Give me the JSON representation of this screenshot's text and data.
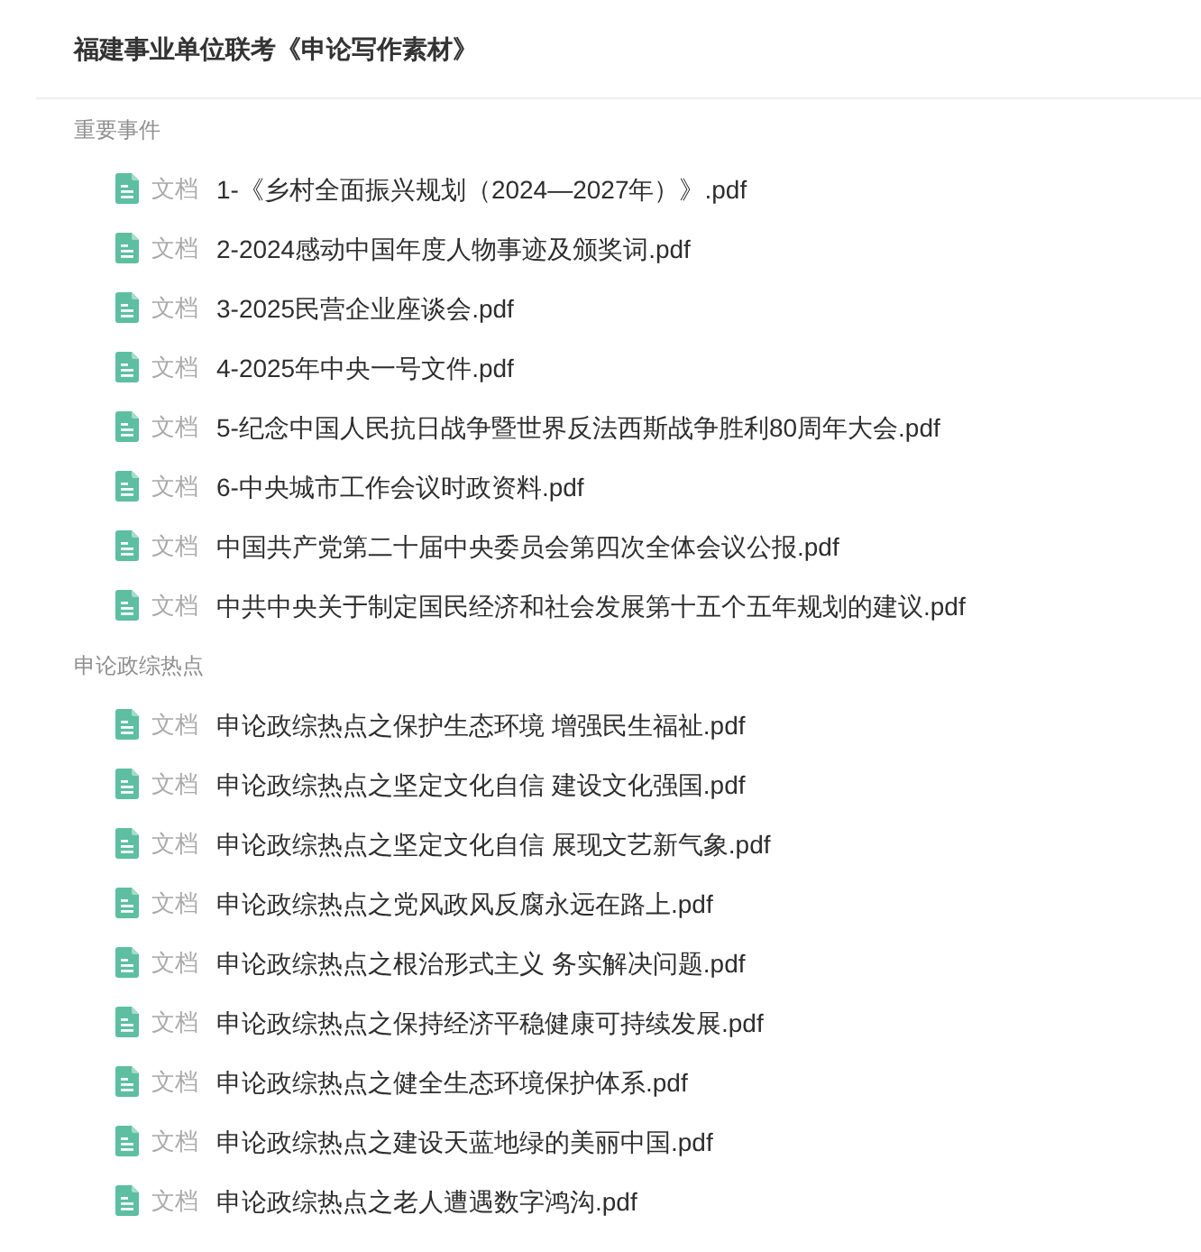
{
  "title": "福建事业单位联考《申论写作素材》",
  "sections": [
    {
      "label": "重要事件",
      "items": [
        {
          "type_label": "文档",
          "name": "1-《乡村全面振兴规划（2024—2027年）》.pdf"
        },
        {
          "type_label": "文档",
          "name": "2-2024感动中国年度人物事迹及颁奖词.pdf"
        },
        {
          "type_label": "文档",
          "name": "3-2025民营企业座谈会.pdf"
        },
        {
          "type_label": "文档",
          "name": "4-2025年中央一号文件.pdf"
        },
        {
          "type_label": "文档",
          "name": "5-纪念中国人民抗日战争暨世界反法西斯战争胜利80周年大会.pdf"
        },
        {
          "type_label": "文档",
          "name": "6-中央城市工作会议时政资料.pdf"
        },
        {
          "type_label": "文档",
          "name": "中国共产党第二十届中央委员会第四次全体会议公报.pdf"
        },
        {
          "type_label": "文档",
          "name": "中共中央关于制定国民经济和社会发展第十五个五年规划的建议.pdf"
        }
      ]
    },
    {
      "label": "申论政综热点",
      "items": [
        {
          "type_label": "文档",
          "name": "申论政综热点之保护生态环境 增强民生福祉.pdf"
        },
        {
          "type_label": "文档",
          "name": "申论政综热点之坚定文化自信 建设文化强国.pdf"
        },
        {
          "type_label": "文档",
          "name": "申论政综热点之坚定文化自信 展现文艺新气象.pdf"
        },
        {
          "type_label": "文档",
          "name": "申论政综热点之党风政风反腐永远在路上.pdf"
        },
        {
          "type_label": "文档",
          "name": "申论政综热点之根治形式主义 务实解决问题.pdf"
        },
        {
          "type_label": "文档",
          "name": "申论政综热点之保持经济平稳健康可持续发展.pdf"
        },
        {
          "type_label": "文档",
          "name": "申论政综热点之健全生态环境保护体系.pdf"
        },
        {
          "type_label": "文档",
          "name": "申论政综热点之建设天蓝地绿的美丽中国.pdf"
        },
        {
          "type_label": "文档",
          "name": "申论政综热点之老人遭遇数字鸿沟.pdf"
        }
      ]
    }
  ]
}
